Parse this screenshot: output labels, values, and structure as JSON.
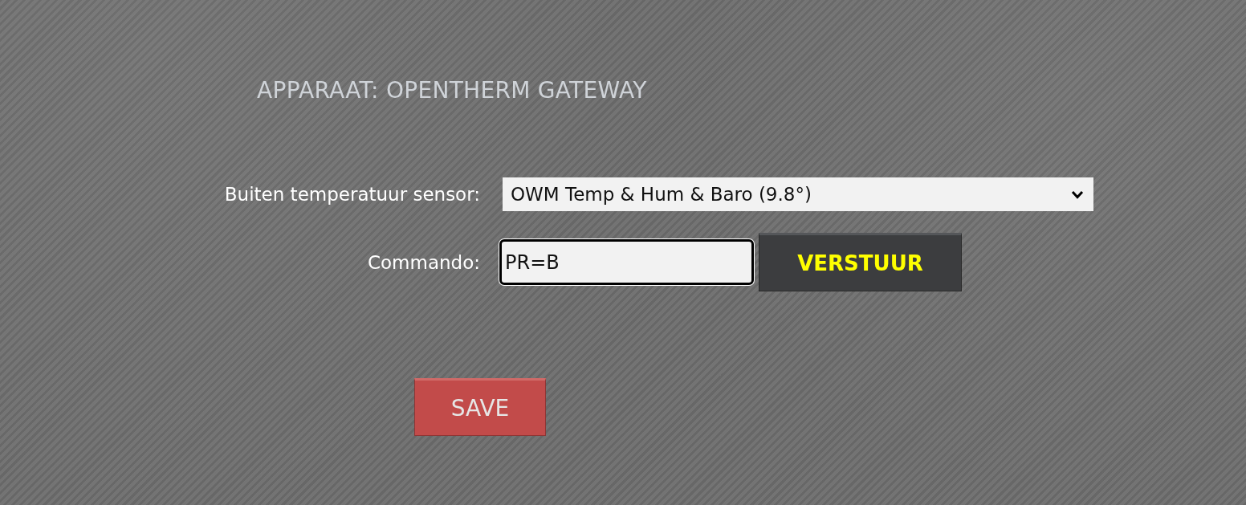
{
  "page": {
    "title": "APPARAAT: OPENTHERM GATEWAY"
  },
  "form": {
    "fields": [
      {
        "kind": "dropdown",
        "label": "Buiten temperatuur sensor:",
        "value": "OWM Temp & Hum & Baro (9.8°)"
      },
      {
        "kind": "text",
        "label": "Commando:",
        "value": "PR=B",
        "focused": true,
        "button": "VERSTUUR"
      }
    ]
  },
  "save_button": {
    "label": "SAVE"
  }
}
